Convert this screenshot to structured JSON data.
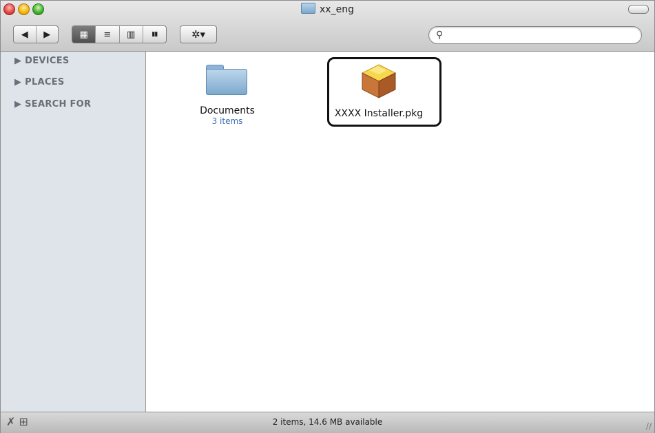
{
  "window": {
    "title": "xx_eng"
  },
  "toolbar": {
    "back_glyph": "◀",
    "forward_glyph": "▶",
    "view_icon_glyph": "▦",
    "view_list_glyph": "≡",
    "view_column_glyph": "▥",
    "view_coverflow_glyph": "▮▮",
    "action_glyph": "✲▾",
    "search_placeholder": ""
  },
  "sidebar": {
    "items": [
      {
        "label": "▶ DEVICES"
      },
      {
        "label": "▶ PLACES"
      },
      {
        "label": "▶ SEARCH FOR"
      }
    ]
  },
  "files": [
    {
      "name": "Documents",
      "sub": "3 items",
      "icon": "folder-icon"
    },
    {
      "name": "XXXX Installer.pkg",
      "sub": "",
      "icon": "package-icon"
    }
  ],
  "statusbar": {
    "text": "2 items, 14.6 MB available",
    "left_glyphs": "✗ ⊞"
  },
  "colors": {
    "sidebar_bg": "#dfe4ea",
    "highlight_border": "#111111",
    "sub_label": "#3c6fb3"
  }
}
